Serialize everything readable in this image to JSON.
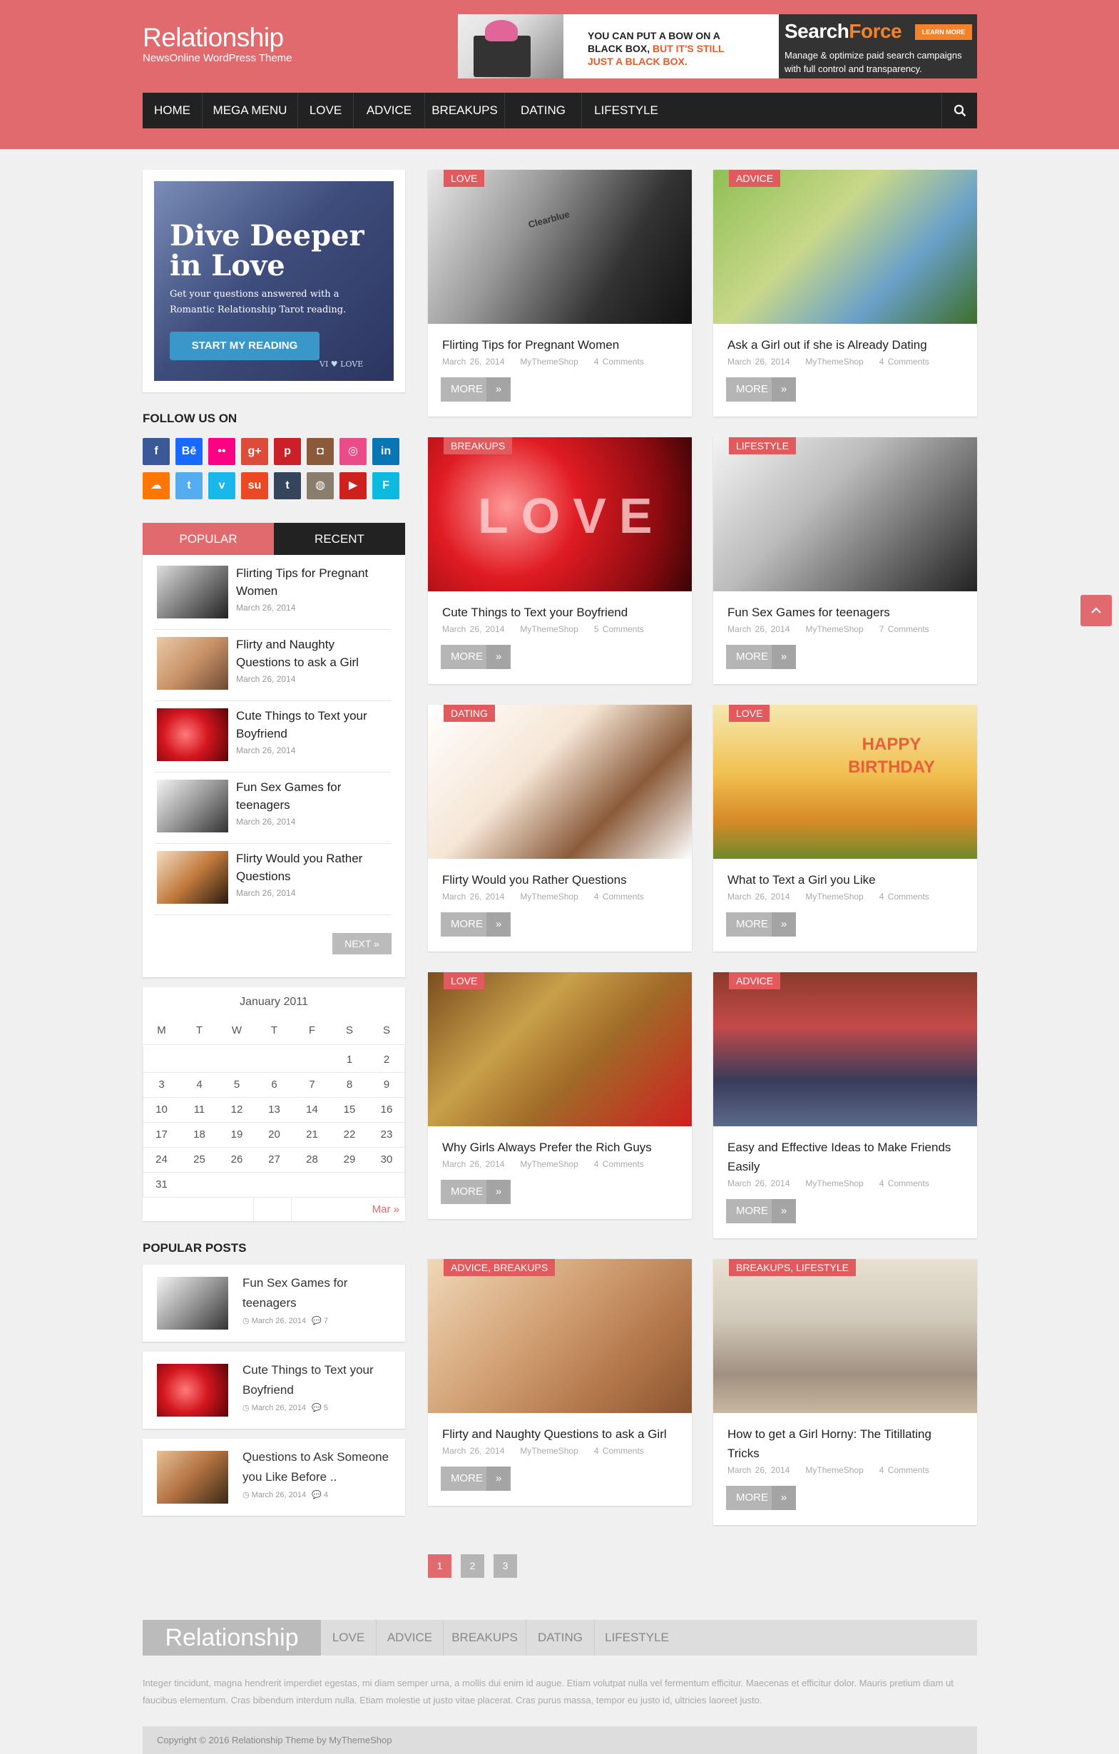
{
  "site": {
    "title": "Relationship",
    "tagline": "NewsOnline WordPress Theme"
  },
  "ad": {
    "line1": "YOU CAN PUT A BOW ON A",
    "line2_a": "BLACK BOX, ",
    "line2_b": "BUT IT'S STILL",
    "line3": "JUST A BLACK BOX.",
    "brand_a": "Search",
    "brand_b": "Force",
    "learn": "LEARN MORE",
    "sub": "Manage & optimize paid search campaigns with full control and transparency."
  },
  "nav": {
    "items": [
      "HOME",
      "MEGA MENU",
      "LOVE",
      "ADVICE",
      "BREAKUPS",
      "DATING",
      "LIFESTYLE"
    ]
  },
  "tarot": {
    "heading": "Dive Deeper in Love",
    "text": "Get your questions answered with a Romantic Relationship Tarot reading.",
    "button": "START MY READING",
    "card": "VI ♥ LOVE"
  },
  "follow": {
    "title": "FOLLOW US ON",
    "icons": [
      {
        "name": "facebook",
        "glyph": "f",
        "color": "#3b5998"
      },
      {
        "name": "behance",
        "glyph": "Bē",
        "color": "#1769ff"
      },
      {
        "name": "flickr",
        "glyph": "••",
        "color": "#ff0084"
      },
      {
        "name": "google-plus",
        "glyph": "g+",
        "color": "#dd4b39"
      },
      {
        "name": "pinterest",
        "glyph": "p",
        "color": "#cb2027"
      },
      {
        "name": "instagram",
        "glyph": "◘",
        "color": "#8a5a3b"
      },
      {
        "name": "dribbble",
        "glyph": "◎",
        "color": "#ea4c89"
      },
      {
        "name": "linkedin",
        "glyph": "in",
        "color": "#0976b4"
      },
      {
        "name": "soundcloud",
        "glyph": "☁",
        "color": "#ff7700"
      },
      {
        "name": "twitter",
        "glyph": "t",
        "color": "#55acee"
      },
      {
        "name": "vimeo",
        "glyph": "v",
        "color": "#1ab7ea"
      },
      {
        "name": "stumbleupon",
        "glyph": "su",
        "color": "#eb4924"
      },
      {
        "name": "tumblr",
        "glyph": "t",
        "color": "#35465c"
      },
      {
        "name": "github",
        "glyph": "◍",
        "color": "#8b7d6b"
      },
      {
        "name": "youtube",
        "glyph": "▶",
        "color": "#cd201f"
      },
      {
        "name": "foursquare",
        "glyph": "F",
        "color": "#0cbadf"
      }
    ]
  },
  "tabs": {
    "popular": "POPULAR",
    "recent": "RECENT",
    "next": "NEXT »",
    "items": [
      {
        "title": "Flirting Tips for Pregnant Women",
        "date": "March 26, 2014"
      },
      {
        "title": "Flirty and Naughty Questions to ask a Girl",
        "date": "March 26, 2014"
      },
      {
        "title": "Cute Things to Text your Boyfriend",
        "date": "March 26, 2014"
      },
      {
        "title": "Fun Sex Games for teenagers",
        "date": "March 26, 2014"
      },
      {
        "title": "Flirty Would you Rather Questions",
        "date": "March 26, 2014"
      }
    ]
  },
  "calendar": {
    "caption": "January 2011",
    "days": [
      "M",
      "T",
      "W",
      "T",
      "F",
      "S",
      "S"
    ],
    "weeks": [
      [
        "",
        "",
        "",
        "",
        "",
        "1",
        "2"
      ],
      [
        "3",
        "4",
        "5",
        "6",
        "7",
        "8",
        "9"
      ],
      [
        "10",
        "11",
        "12",
        "13",
        "14",
        "15",
        "16"
      ],
      [
        "17",
        "18",
        "19",
        "20",
        "21",
        "22",
        "23"
      ],
      [
        "24",
        "25",
        "26",
        "27",
        "28",
        "29",
        "30"
      ],
      [
        "31",
        "",
        "",
        "",
        "",
        "",
        ""
      ]
    ],
    "next": "Mar »"
  },
  "popular_posts": {
    "title": "POPULAR POSTS",
    "items": [
      {
        "title": "Fun Sex Games for teenagers",
        "date": "March 26, 2014",
        "comments": "7"
      },
      {
        "title": "Cute Things to Text your Boyfriend",
        "date": "March 26, 2014",
        "comments": "5"
      },
      {
        "title": "Questions to Ask Someone you Like Before ..",
        "date": "March 26, 2014",
        "comments": "4"
      }
    ]
  },
  "posts": [
    {
      "cat": "LOVE",
      "title": "Flirting Tips for Pregnant Women",
      "date": "March 26, 2014",
      "author": "MyThemeShop",
      "comments": "4 Comments"
    },
    {
      "cat": "ADVICE",
      "title": "Ask a Girl out if she is Already Dating",
      "date": "March 26, 2014",
      "author": "MyThemeShop",
      "comments": "4 Comments"
    },
    {
      "cat": "BREAKUPS",
      "title": "Cute Things to Text your Boyfriend",
      "date": "March 26, 2014",
      "author": "MyThemeShop",
      "comments": "5 Comments"
    },
    {
      "cat": "LIFESTYLE",
      "title": "Fun Sex Games for teenagers",
      "date": "March 26, 2014",
      "author": "MyThemeShop",
      "comments": "7 Comments"
    },
    {
      "cat": "DATING",
      "title": "Flirty Would you Rather Questions",
      "date": "March 26, 2014",
      "author": "MyThemeShop",
      "comments": "4 Comments"
    },
    {
      "cat": "LOVE",
      "title": "What to Text a Girl you Like",
      "date": "March 26, 2014",
      "author": "MyThemeShop",
      "comments": "4 Comments"
    },
    {
      "cat": "LOVE",
      "title": "Why Girls Always Prefer the Rich Guys",
      "date": "March 26, 2014",
      "author": "MyThemeShop",
      "comments": "4 Comments"
    },
    {
      "cat": "ADVICE",
      "title": "Easy and Effective Ideas to Make Friends Easily",
      "date": "March 26, 2014",
      "author": "MyThemeShop",
      "comments": "4 Comments"
    },
    {
      "cat": "ADVICE, BREAKUPS",
      "title": "Flirty and Naughty Questions to ask a Girl",
      "date": "March 26, 2014",
      "author": "MyThemeShop",
      "comments": "4 Comments"
    },
    {
      "cat": "BREAKUPS, LIFESTYLE",
      "title": "How to get a Girl Horny: The Titillating Tricks",
      "date": "March 26, 2014",
      "author": "MyThemeShop",
      "comments": "4 Comments"
    }
  ],
  "more_label": "MORE",
  "photo_text": {
    "brand": "Clearblue",
    "love": "LOVE",
    "birthday": "HAPPY BIRTHDAY"
  },
  "pagination": [
    "1",
    "2",
    "3"
  ],
  "footer": {
    "logo": "Relationship",
    "nav": [
      "LOVE",
      "ADVICE",
      "BREAKUPS",
      "DATING",
      "LIFESTYLE"
    ],
    "text": "Integer tincidunt, magna hendrerit imperdiet egestas, mi diam semper urna, a mollis dui enim id augue. Etiam volutpat nulla vel fermentum efficitur. Maecenas et efficitur dolor. Mauris pretium diam ut faucibus elementum. Cras bibendum interdum nulla. Etiam molestie ut justo vitae placerat. Cras purus massa, tempor eu justo id, ultricies laoreet justo.",
    "copyright": "Copyright © 2016 Relationship Theme by MyThemeShop"
  }
}
